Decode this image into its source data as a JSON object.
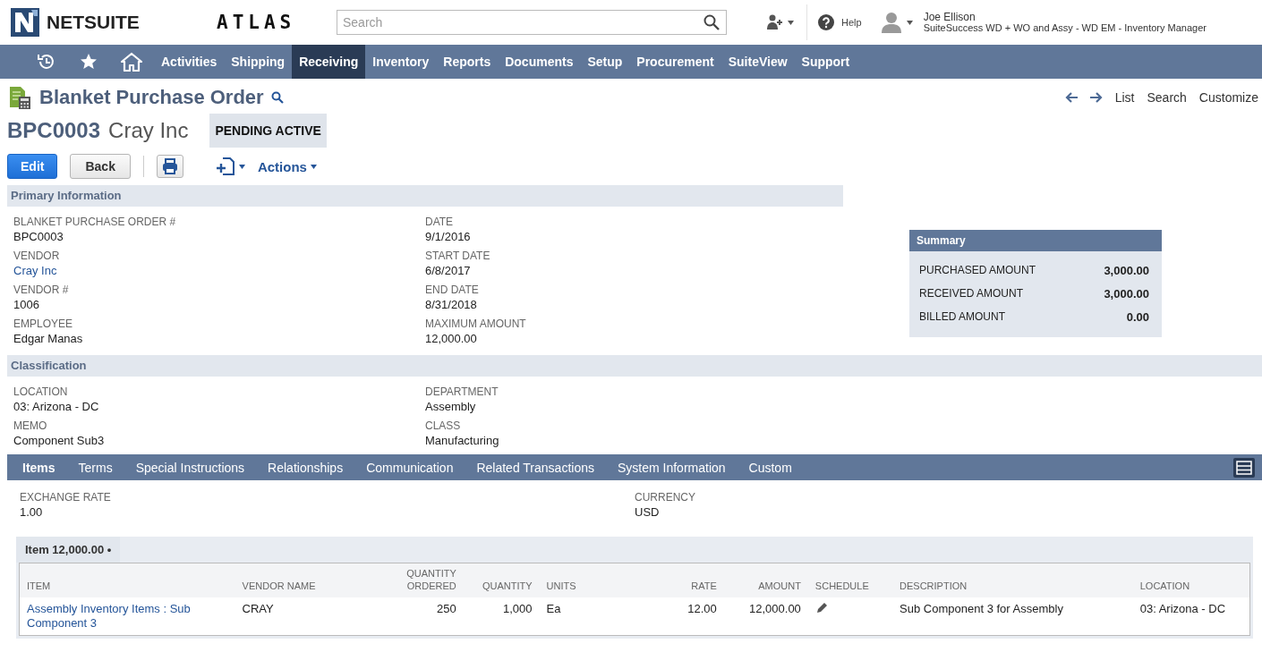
{
  "header": {
    "logo": "NETSUITE",
    "brand": "ATLAS",
    "search": {
      "placeholder": "Search"
    },
    "help": "Help",
    "user": {
      "name": "Joe Ellison",
      "role": "SuiteSuccess WD + WO and Assy - WD EM - Inventory Manager"
    }
  },
  "nav": {
    "items": [
      {
        "label": "Activities",
        "selected": false
      },
      {
        "label": "Shipping",
        "selected": false
      },
      {
        "label": "Receiving",
        "selected": true
      },
      {
        "label": "Inventory",
        "selected": false
      },
      {
        "label": "Reports",
        "selected": false
      },
      {
        "label": "Documents",
        "selected": false
      },
      {
        "label": "Setup",
        "selected": false
      },
      {
        "label": "Procurement",
        "selected": false
      },
      {
        "label": "SuiteView",
        "selected": false
      },
      {
        "label": "Support",
        "selected": false
      }
    ]
  },
  "record": {
    "type": "Blanket Purchase Order",
    "number": "BPC0003",
    "name": "Cray Inc",
    "status": "PENDING ACTIVE",
    "links": [
      "List",
      "Search",
      "Customize"
    ],
    "edit": "Edit",
    "back": "Back",
    "actions": "Actions"
  },
  "primary": {
    "title": "Primary Information",
    "columns": [
      [
        {
          "label": "BLANKET PURCHASE ORDER #",
          "value": "BPC0003",
          "link": false
        },
        {
          "label": "VENDOR",
          "value": "Cray Inc",
          "link": true
        },
        {
          "label": "VENDOR #",
          "value": "1006",
          "link": false
        },
        {
          "label": "EMPLOYEE",
          "value": "Edgar Manas",
          "link": false
        }
      ],
      [
        {
          "label": "DATE",
          "value": "9/1/2016",
          "link": false
        },
        {
          "label": "START DATE",
          "value": "6/8/2017",
          "link": false
        },
        {
          "label": "END DATE",
          "value": "8/31/2018",
          "link": false
        },
        {
          "label": "MAXIMUM AMOUNT",
          "value": "12,000.00",
          "link": false
        }
      ]
    ]
  },
  "summary": {
    "title": "Summary",
    "rows": [
      {
        "label": "PURCHASED AMOUNT",
        "value": "3,000.00"
      },
      {
        "label": "RECEIVED AMOUNT",
        "value": "3,000.00"
      },
      {
        "label": "BILLED AMOUNT",
        "value": "0.00"
      }
    ]
  },
  "classification": {
    "title": "Classification",
    "columns": [
      [
        {
          "label": "LOCATION",
          "value": "03: Arizona - DC",
          "link": false
        },
        {
          "label": "MEMO",
          "value": "Component Sub3",
          "link": false
        }
      ],
      [
        {
          "label": "DEPARTMENT",
          "value": "Assembly",
          "link": false
        },
        {
          "label": "CLASS",
          "value": "Manufacturing",
          "link": false
        }
      ]
    ]
  },
  "subtabs": [
    {
      "label": "Items",
      "selected": true
    },
    {
      "label": "Terms",
      "selected": false
    },
    {
      "label": "Special Instructions",
      "selected": false
    },
    {
      "label": "Relationships",
      "selected": false
    },
    {
      "label": "Communication",
      "selected": false
    },
    {
      "label": "Related Transactions",
      "selected": false
    },
    {
      "label": "System Information",
      "selected": false
    },
    {
      "label": "Custom",
      "selected": false
    }
  ],
  "items_tab": {
    "fields": [
      {
        "label": "EXCHANGE RATE",
        "value": "1.00",
        "link": false
      },
      {
        "label": "CURRENCY",
        "value": "USD",
        "link": false
      }
    ],
    "sublist": {
      "tab": "Item 12,000.00 •",
      "columns": [
        {
          "label": "ITEM"
        },
        {
          "label": "VENDOR NAME"
        },
        {
          "label": "QUANTITY ORDERED"
        },
        {
          "label": "QUANTITY"
        },
        {
          "label": "UNITS"
        },
        {
          "label": "RATE"
        },
        {
          "label": "AMOUNT"
        },
        {
          "label": "SCHEDULE"
        },
        {
          "label": "DESCRIPTION"
        },
        {
          "label": "LOCATION"
        }
      ],
      "rows": [
        {
          "cells": [
            {
              "kind": "link",
              "text": "Assembly Inventory Items : Sub Component 3"
            },
            {
              "kind": "text",
              "text": "CRAY"
            },
            {
              "kind": "number",
              "text": "250"
            },
            {
              "kind": "number",
              "text": "1,000"
            },
            {
              "kind": "text",
              "text": "Ea"
            },
            {
              "kind": "number",
              "text": "12.00"
            },
            {
              "kind": "number",
              "text": "12,000.00"
            },
            {
              "kind": "edit"
            },
            {
              "kind": "text",
              "text": "Sub Component 3 for Assembly"
            },
            {
              "kind": "text",
              "text": "03: Arizona - DC"
            }
          ]
        }
      ]
    }
  }
}
